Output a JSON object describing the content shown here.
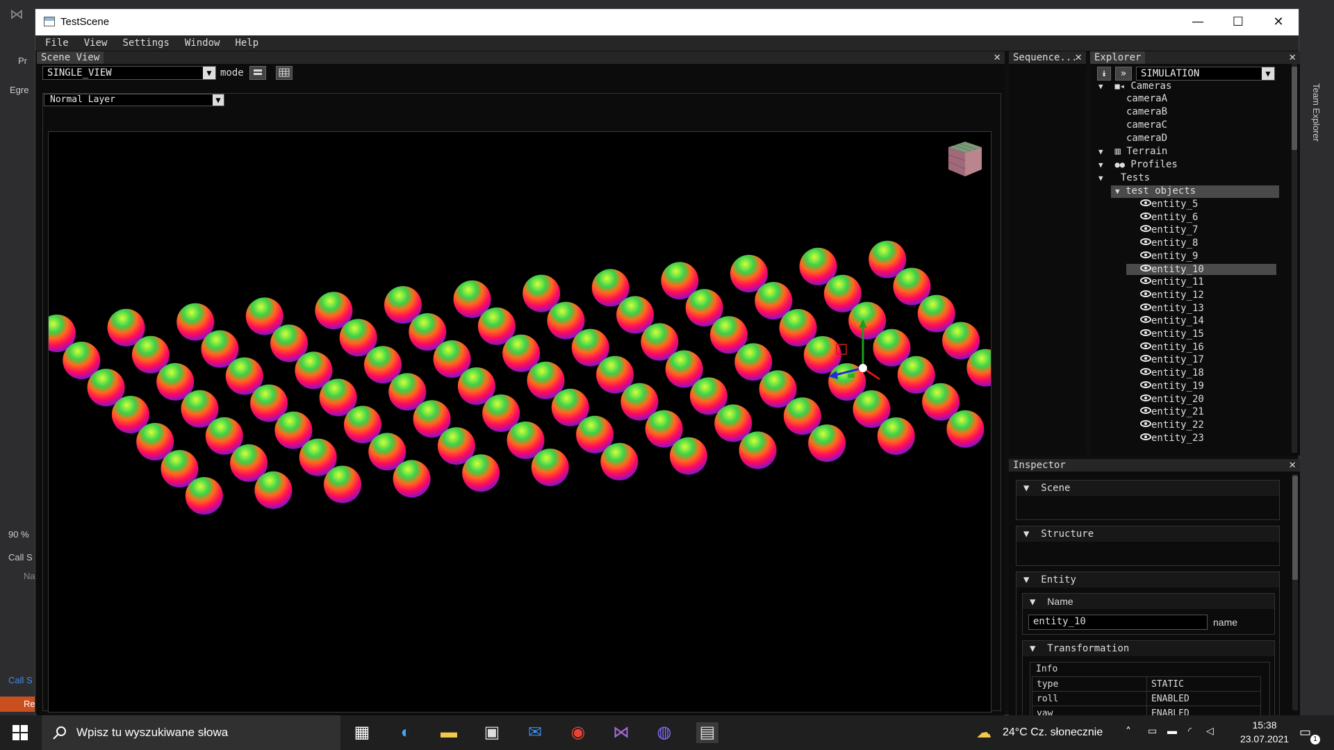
{
  "window": {
    "title": "TestScene",
    "minimize": "—",
    "maximize": "☐",
    "close": "✕"
  },
  "menu": [
    "File",
    "View",
    "Settings",
    "Window",
    "Help"
  ],
  "scene_view": {
    "tab": "Scene View",
    "view_mode": "SINGLE_VIEW",
    "mode_label": "mode",
    "layer": "Normal Layer",
    "close": "✕"
  },
  "sequence": {
    "tab": "Sequence...",
    "close": "✕"
  },
  "explorer": {
    "tab": "Explorer",
    "close": "✕",
    "mode": "SIMULATION",
    "tree": {
      "cameras": "Cameras",
      "camera_items": [
        "cameraA",
        "cameraB",
        "cameraC",
        "cameraD"
      ],
      "terrain": "Terrain",
      "profiles": "Profiles",
      "tests": "Tests",
      "test_objects": "test objects",
      "entities": [
        "entity_5",
        "entity_6",
        "entity_7",
        "entity_8",
        "entity_9",
        "entity_10",
        "entity_11",
        "entity_12",
        "entity_13",
        "entity_14",
        "entity_15",
        "entity_16",
        "entity_17",
        "entity_18",
        "entity_19",
        "entity_20",
        "entity_21",
        "entity_22",
        "entity_23"
      ],
      "selected_entity": "entity_10"
    }
  },
  "inspector": {
    "tab": "Inspector",
    "close": "✕",
    "sections": {
      "scene": "Scene",
      "structure": "Structure",
      "entity": "Entity",
      "name": "Name",
      "transformation": "Transformation"
    },
    "name_value": "entity_10",
    "name_label": "name",
    "info_label": "Info",
    "info_rows": [
      {
        "key": "type",
        "value": "STATIC"
      },
      {
        "key": "roll",
        "value": "ENABLED"
      },
      {
        "key": "yaw",
        "value": "ENABLED"
      }
    ]
  },
  "background_ide": {
    "labels": [
      "Pr",
      "Egre",
      "90 %",
      "Call S",
      "Na",
      "Call S",
      "Re",
      "Team Explorer"
    ]
  },
  "taskbar": {
    "search_placeholder": "Wpisz tu wyszukiwane słowa",
    "weather": "24°C  Cz. słonecznie",
    "time": "15:38",
    "date": "23.07.2021",
    "notification_count": "1"
  },
  "colors": {
    "accent_selected": "#4a4a4a",
    "panel_bg": "#0c0c0c",
    "header_bg": "#262626"
  }
}
